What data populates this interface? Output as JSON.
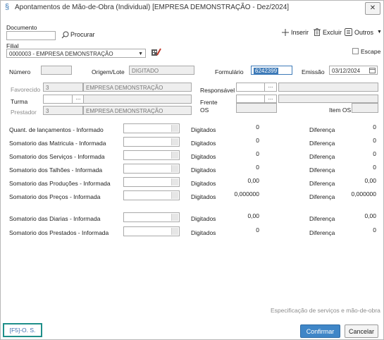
{
  "window": {
    "title": "Apontamentos de Mão-de-Obra (Individual) [EMPRESA DEMONSTRAÇÃO - Dez/2024]",
    "close_glyph": "✕"
  },
  "header": {
    "documento_label": "Documento",
    "documento_value": "",
    "procurar_label": "Procurar",
    "filial_label": "Filial",
    "filial_value": "0000003 - EMPRESA DEMONSTRAÇÃO",
    "toolbar": {
      "inserir": "Inserir",
      "excluir": "Excluir",
      "outros": "Outros"
    },
    "escape_label": "Escape"
  },
  "form": {
    "numero_label": "Número",
    "numero_value": "",
    "origem_label": "Origem/Lote",
    "origem_value": "DIGITADO",
    "formulario_label": "Formulário",
    "formulario_value": "6242399",
    "emissao_label": "Emissão",
    "emissao_value": "03/12/2024",
    "favorecido_label": "Favorecido",
    "favorecido_code": "3",
    "favorecido_name": "EMPRESA DEMONSTRAÇÃO",
    "responsavel_label": "Responsável",
    "turma_label": "Turma",
    "frente_label": "Frente",
    "prestador_label": "Prestador",
    "prestador_code": "3",
    "prestador_name": "EMPRESA DEMONSTRAÇÃO",
    "os_label": "OS",
    "item_os_label": "Item OS",
    "ellipsis": "..."
  },
  "totals": {
    "digitados_label": "Digitados",
    "diferenca_label": "Diferença",
    "rows": [
      {
        "label": "Quant. de lançamentos - Informado",
        "digitados": "0",
        "diferenca": "0"
      },
      {
        "label": "Somatorio das Matricula - Informada",
        "digitados": "0",
        "diferenca": "0"
      },
      {
        "label": "Somatorio dos Serviços - Informada",
        "digitados": "0",
        "diferenca": "0"
      },
      {
        "label": "Somatorio dos Talhões - Informada",
        "digitados": "0",
        "diferenca": "0"
      },
      {
        "label": "Somatorio das Produções - Informada",
        "digitados": "0,00",
        "diferenca": "0,00"
      },
      {
        "label": "Somatorio dos Preços - Informada",
        "digitados": "0,000000",
        "diferenca": "0,000000"
      },
      {
        "label": "Somatorio das Diarias - Informada",
        "digitados": "0,00",
        "diferenca": "0,00"
      },
      {
        "label": "Somatorio dos Prestados - Informada",
        "digitados": "0",
        "diferenca": "0"
      }
    ]
  },
  "footer": {
    "especificacao_label": "Especificação de serviços e mão-de-obra",
    "f5_label": "[F5]-O. S.",
    "confirmar_label": "Confirmar",
    "cancelar_label": "Cancelar"
  },
  "colors": {
    "accent": "#3f86c7",
    "f5_border": "#1f8f8a",
    "readonly_bg": "#eeeeee"
  }
}
